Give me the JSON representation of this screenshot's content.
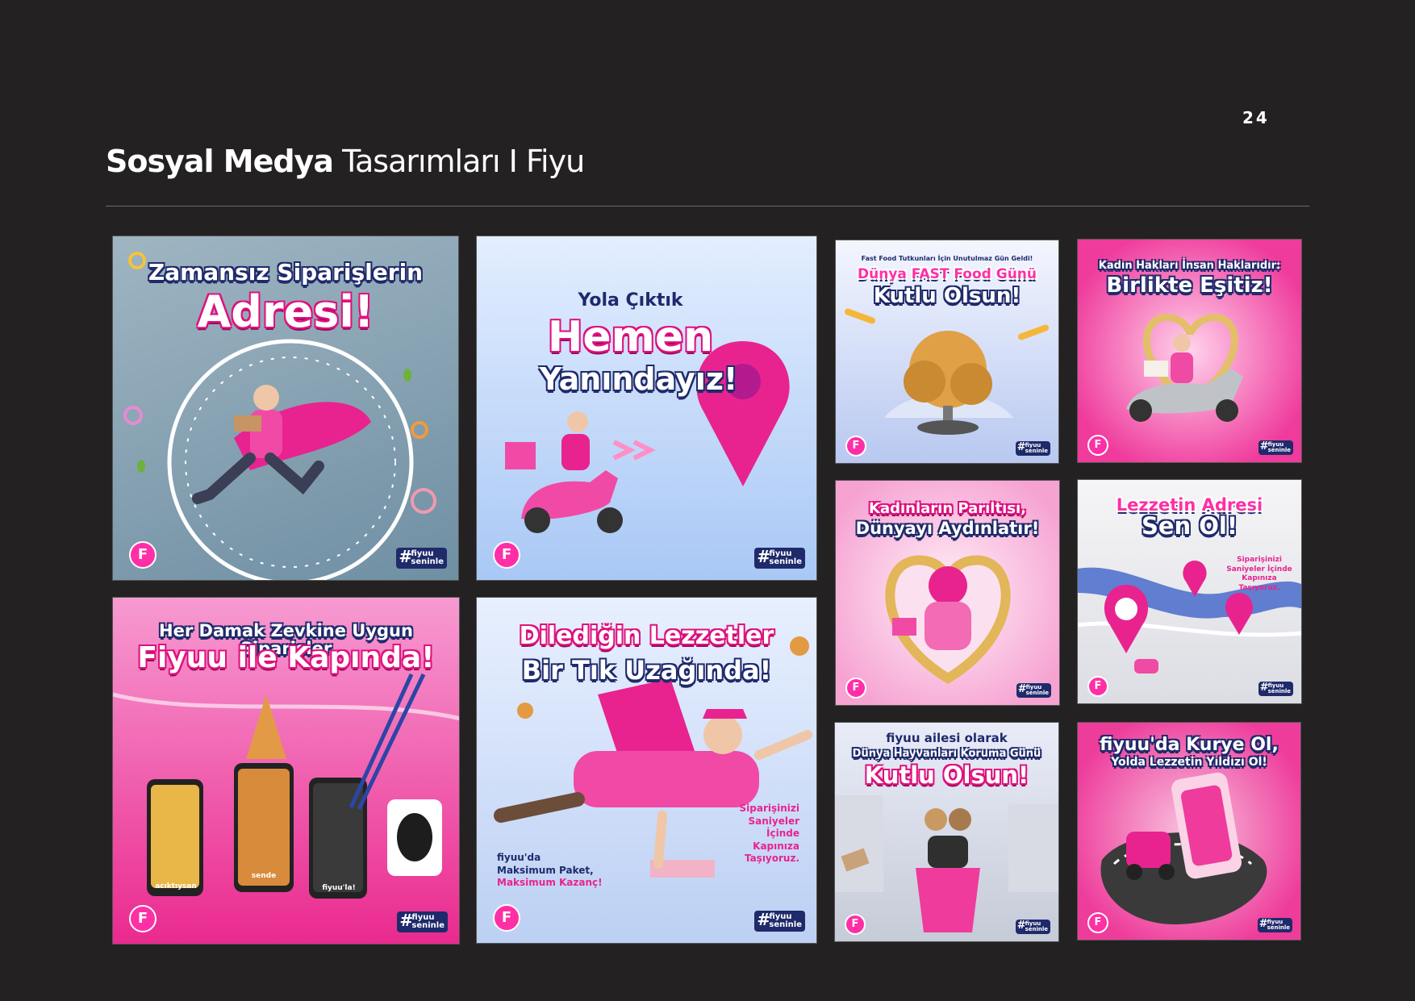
{
  "page_number": "24",
  "title": {
    "bold": "Sosyal Medya",
    "light": "Tasarımları I Fiyu"
  },
  "brand": {
    "logo_letter": "F",
    "hashtag": "#",
    "tag_line1": "fiyuu",
    "tag_line2": "seninle"
  },
  "tiles": {
    "t1": {
      "line1": "Zamansız Siparişlerin",
      "line2": "Adresi!"
    },
    "t2": {
      "line1": "Yola Çıktık",
      "line2": "Hemen",
      "line3": "Yanındayız!"
    },
    "t3": {
      "top": "Fast Food Tutkunları İçin Unutulmaz Gün Geldi!",
      "line1": "Dünya FAST Food Günü",
      "line2": "Kutlu Olsun!"
    },
    "t4": {
      "line1": "Kadın Hakları İnsan Haklarıdır:",
      "line2": "Birlikte Eşitiz!"
    },
    "t5": {
      "line1": "Kadınların Parıltısı,",
      "line2": "Dünyayı Aydınlatır!"
    },
    "t6": {
      "line1": "Lezzetin Adresi",
      "line2": "Sen Ol!",
      "note": "Siparişinizi Saniyeler İçinde Kapınıza Taşıyoruz."
    },
    "t7": {
      "line1": "Her Damak Zevkine Uygun Siparişler",
      "line2": "Fiyuu ile Kapında!",
      "phone1": "acıktıysan",
      "phone2": "sende",
      "phone3": "fiyuu'la!"
    },
    "t8": {
      "line1": "Dilediğin Lezzetler",
      "line2": "Bir Tık Uzağında!",
      "left_note1": "fiyuu'da",
      "left_note2": "Maksimum Paket,",
      "left_note3": "Maksimum Kazanç!",
      "right_note": "Siparişinizi Saniyeler İçinde Kapınıza Taşıyoruz."
    },
    "t9": {
      "line1": "fiyuu ailesi olarak",
      "line2": "Dünya Hayvanları Koruma Günü",
      "line3": "Kutlu Olsun!"
    },
    "t10": {
      "line1": "fiyuu'da Kurye Ol,",
      "line2": "Yolda Lezzetin Yıldızı Ol!"
    }
  }
}
